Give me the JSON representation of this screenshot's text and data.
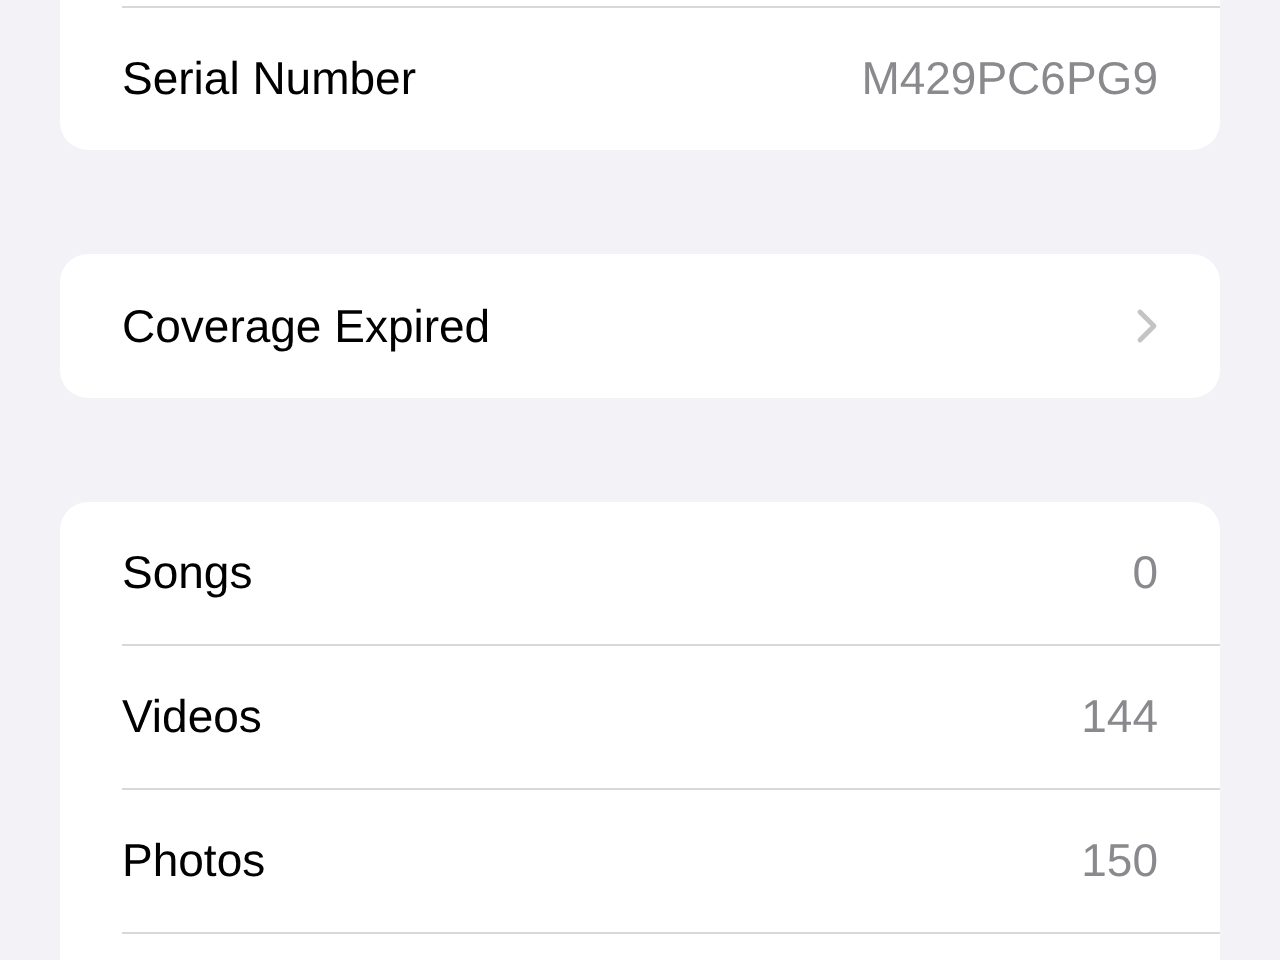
{
  "device_info": {
    "rows": [
      {
        "label": "Serial Number",
        "value": "M429PC6PG9"
      }
    ]
  },
  "coverage": {
    "label": "Coverage Expired"
  },
  "media": {
    "rows": [
      {
        "label": "Songs",
        "value": "0"
      },
      {
        "label": "Videos",
        "value": "144"
      },
      {
        "label": "Photos",
        "value": "150"
      }
    ]
  }
}
